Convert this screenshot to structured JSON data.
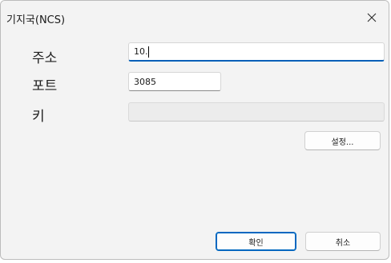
{
  "window": {
    "title": "기지국(NCS)",
    "close_icon": "close-icon"
  },
  "form": {
    "address": {
      "label": "주소",
      "value": "10."
    },
    "port": {
      "label": "포트",
      "value": "3085"
    },
    "key": {
      "label": "키",
      "value": ""
    }
  },
  "buttons": {
    "settings_label": "설정...",
    "ok_label": "확인",
    "cancel_label": "취소"
  },
  "colors": {
    "accent": "#005fb8",
    "window_bg": "#f3f3f3"
  }
}
